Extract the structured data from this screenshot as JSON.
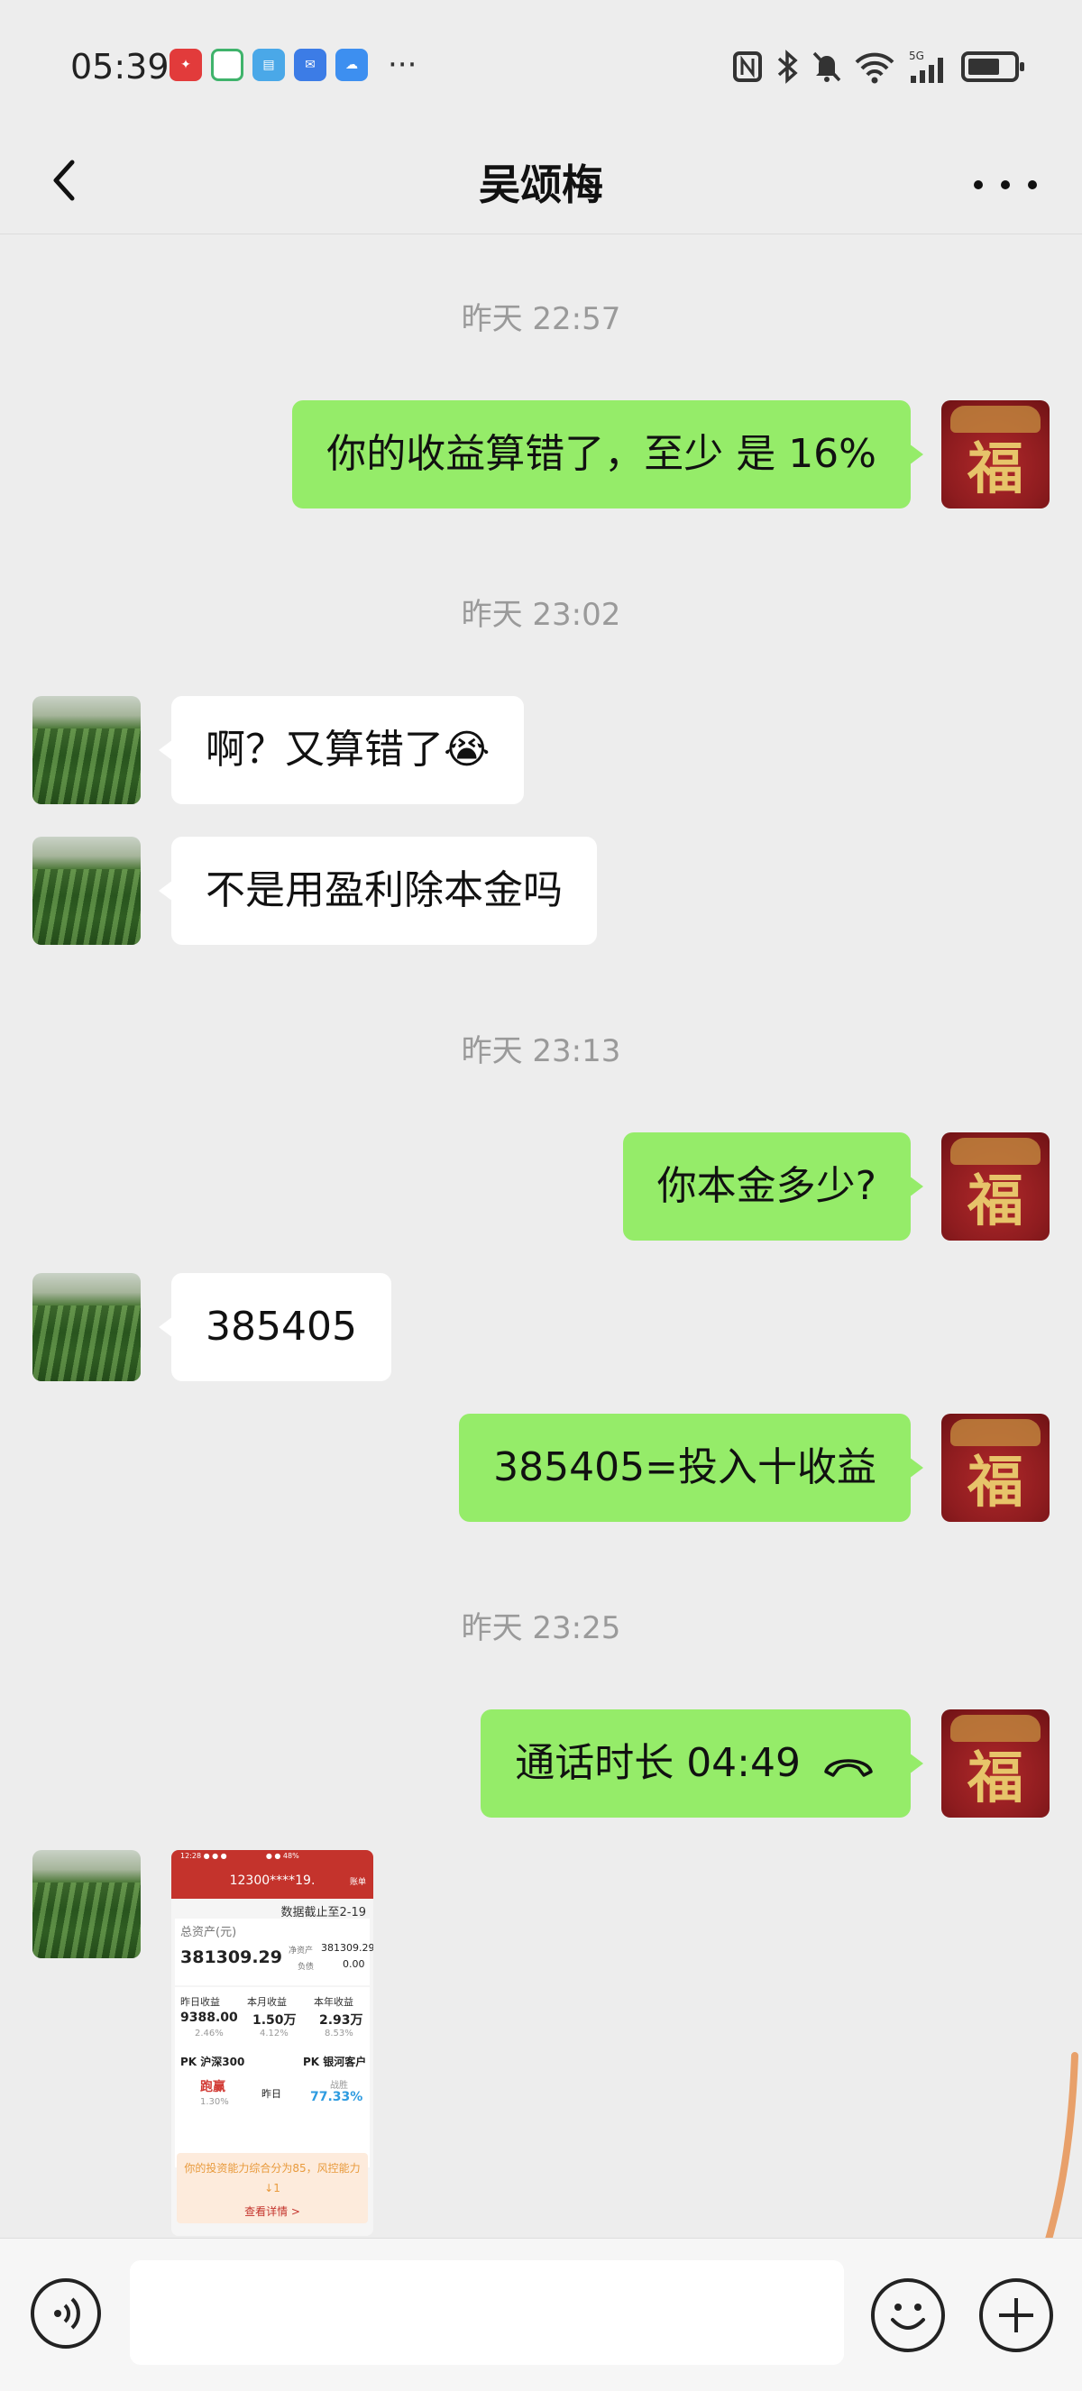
{
  "status_bar": {
    "time": "05:39",
    "app_icons": [
      "app-icon-red",
      "app-icon-green",
      "app-icon-blue-book",
      "app-icon-blue-mail",
      "app-icon-cloud"
    ],
    "more": "···",
    "network": "5G"
  },
  "header": {
    "title": "吴颂梅"
  },
  "messages": [
    {
      "type": "timestamp",
      "text": "昨天 22:57"
    },
    {
      "type": "sent",
      "text": "你的收益算错了，至少 是 16%"
    },
    {
      "type": "timestamp",
      "text": "昨天 23:02"
    },
    {
      "type": "received",
      "text": "啊？又算错了😭"
    },
    {
      "type": "received",
      "text": "不是用盈利除本金吗"
    },
    {
      "type": "timestamp",
      "text": "昨天 23:13"
    },
    {
      "type": "sent",
      "text": "你本金多少?"
    },
    {
      "type": "received",
      "text": "385405"
    },
    {
      "type": "sent",
      "text": "385405=投入十收益"
    },
    {
      "type": "timestamp",
      "text": "昨天 23:25"
    },
    {
      "type": "sent_call",
      "text": "通话时长 04:49"
    },
    {
      "type": "received_image"
    }
  ],
  "screenshot": {
    "header": "12300****19.",
    "top_right": "账单",
    "data_date": "数据截止至2-19",
    "total_label": "总资产(元)",
    "total_value": "381309.29",
    "net_label": "净资产",
    "net_value": "381309.29",
    "debt_label": "负债",
    "debt_value": "0.00",
    "stats": [
      {
        "label": "昨日收益",
        "value": "9388.00",
        "pct": "2.46%"
      },
      {
        "label": "本月收益",
        "value": "1.50万",
        "pct": "4.12%"
      },
      {
        "label": "本年收益",
        "value": "2.93万",
        "pct": "8.53%"
      }
    ],
    "pk_left_label": "PK 沪深300",
    "pk_right_label": "PK 银河客户",
    "pk_left_result": "跑赢",
    "pk_left_pct": "1.30%",
    "pk_mid": "昨日",
    "pk_right_small": "战胜",
    "pk_right_pct": "77.33%",
    "ad_text": "你的投资能力综合分为85，风控能力↓1",
    "ad_link": "查看详情 >"
  }
}
